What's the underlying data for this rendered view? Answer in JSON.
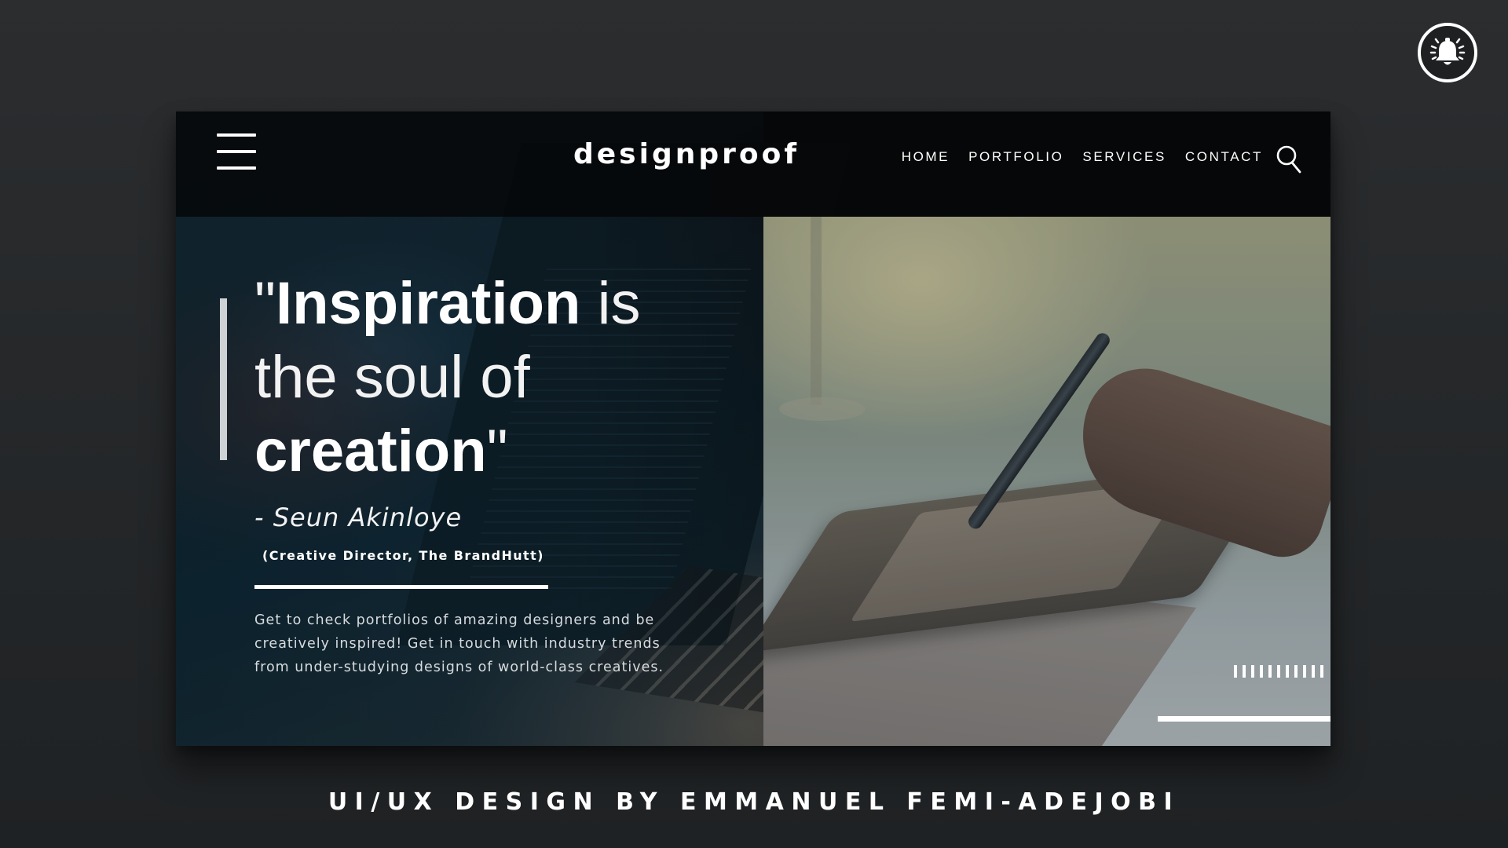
{
  "brand": {
    "logo": "designproof"
  },
  "nav": {
    "items": [
      "HOME",
      "PORTFOLIO",
      "SERVICES",
      "CONTACT"
    ]
  },
  "hero": {
    "headline": {
      "open_quote": "\"",
      "word_bold_1": "Inspiration",
      "word_light_1": " is",
      "line_2": "the soul of",
      "word_bold_2": "creation",
      "close_quote": "\""
    },
    "author": "- Seun Akinloye",
    "author_role": "(Creative Director, The BrandHutt)",
    "description": "Get to check portfolios of amazing designers and be creatively inspired! Get in touch with industry trends from under-studying designs of world-class creatives."
  },
  "slider": {
    "tick_count": 11
  },
  "credit": "UI/UX DESIGN BY EMMANUEL FEMI-ADEJOBI",
  "icons": {
    "menu": "hamburger-icon",
    "search": "search-icon",
    "notification": "bell-icon"
  },
  "colors": {
    "background": "#2b2d2f",
    "header": "#050607",
    "text": "#ffffff",
    "accent_bar": "#cfd2d4"
  }
}
